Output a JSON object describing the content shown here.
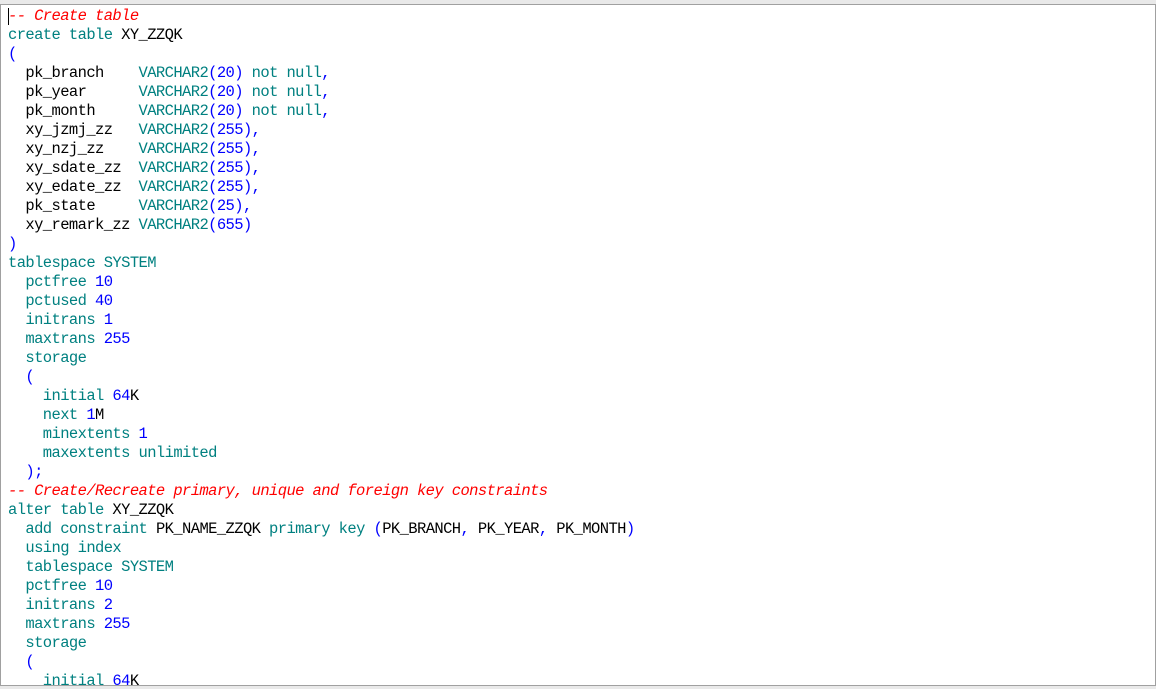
{
  "editor": {
    "lines": [
      [
        {
          "t": "-- Create table",
          "c": "cm"
        }
      ],
      [
        {
          "t": "create table ",
          "c": "kw"
        },
        {
          "t": "XY_ZZQK",
          "c": "id"
        }
      ],
      [
        {
          "t": "(",
          "c": "pun"
        }
      ],
      [
        {
          "t": "  pk_branch    ",
          "c": "id"
        },
        {
          "t": "VARCHAR2",
          "c": "kw"
        },
        {
          "t": "(",
          "c": "pun"
        },
        {
          "t": "20",
          "c": "num"
        },
        {
          "t": ")",
          "c": "pun"
        },
        {
          "t": " not null",
          "c": "kw"
        },
        {
          "t": ",",
          "c": "pun"
        }
      ],
      [
        {
          "t": "  pk_year      ",
          "c": "id"
        },
        {
          "t": "VARCHAR2",
          "c": "kw"
        },
        {
          "t": "(",
          "c": "pun"
        },
        {
          "t": "20",
          "c": "num"
        },
        {
          "t": ")",
          "c": "pun"
        },
        {
          "t": " not null",
          "c": "kw"
        },
        {
          "t": ",",
          "c": "pun"
        }
      ],
      [
        {
          "t": "  pk_month     ",
          "c": "id"
        },
        {
          "t": "VARCHAR2",
          "c": "kw"
        },
        {
          "t": "(",
          "c": "pun"
        },
        {
          "t": "20",
          "c": "num"
        },
        {
          "t": ")",
          "c": "pun"
        },
        {
          "t": " not null",
          "c": "kw"
        },
        {
          "t": ",",
          "c": "pun"
        }
      ],
      [
        {
          "t": "  xy_jzmj_zz   ",
          "c": "id"
        },
        {
          "t": "VARCHAR2",
          "c": "kw"
        },
        {
          "t": "(",
          "c": "pun"
        },
        {
          "t": "255",
          "c": "num"
        },
        {
          "t": ")",
          "c": "pun"
        },
        {
          "t": ",",
          "c": "pun"
        }
      ],
      [
        {
          "t": "  xy_nzj_zz    ",
          "c": "id"
        },
        {
          "t": "VARCHAR2",
          "c": "kw"
        },
        {
          "t": "(",
          "c": "pun"
        },
        {
          "t": "255",
          "c": "num"
        },
        {
          "t": ")",
          "c": "pun"
        },
        {
          "t": ",",
          "c": "pun"
        }
      ],
      [
        {
          "t": "  xy_sdate_zz  ",
          "c": "id"
        },
        {
          "t": "VARCHAR2",
          "c": "kw"
        },
        {
          "t": "(",
          "c": "pun"
        },
        {
          "t": "255",
          "c": "num"
        },
        {
          "t": ")",
          "c": "pun"
        },
        {
          "t": ",",
          "c": "pun"
        }
      ],
      [
        {
          "t": "  xy_edate_zz  ",
          "c": "id"
        },
        {
          "t": "VARCHAR2",
          "c": "kw"
        },
        {
          "t": "(",
          "c": "pun"
        },
        {
          "t": "255",
          "c": "num"
        },
        {
          "t": ")",
          "c": "pun"
        },
        {
          "t": ",",
          "c": "pun"
        }
      ],
      [
        {
          "t": "  pk_state     ",
          "c": "id"
        },
        {
          "t": "VARCHAR2",
          "c": "kw"
        },
        {
          "t": "(",
          "c": "pun"
        },
        {
          "t": "25",
          "c": "num"
        },
        {
          "t": ")",
          "c": "pun"
        },
        {
          "t": ",",
          "c": "pun"
        }
      ],
      [
        {
          "t": "  xy_remark_zz ",
          "c": "id"
        },
        {
          "t": "VARCHAR2",
          "c": "kw"
        },
        {
          "t": "(",
          "c": "pun"
        },
        {
          "t": "655",
          "c": "num"
        },
        {
          "t": ")",
          "c": "pun"
        }
      ],
      [
        {
          "t": ")",
          "c": "pun"
        }
      ],
      [
        {
          "t": "tablespace ",
          "c": "kw"
        },
        {
          "t": "SYSTEM",
          "c": "kw"
        }
      ],
      [
        {
          "t": "  pctfree ",
          "c": "kw"
        },
        {
          "t": "10",
          "c": "num"
        }
      ],
      [
        {
          "t": "  pctused ",
          "c": "kw"
        },
        {
          "t": "40",
          "c": "num"
        }
      ],
      [
        {
          "t": "  initrans ",
          "c": "kw"
        },
        {
          "t": "1",
          "c": "num"
        }
      ],
      [
        {
          "t": "  maxtrans ",
          "c": "kw"
        },
        {
          "t": "255",
          "c": "num"
        }
      ],
      [
        {
          "t": "  storage",
          "c": "kw"
        }
      ],
      [
        {
          "t": "  (",
          "c": "pun"
        }
      ],
      [
        {
          "t": "    initial ",
          "c": "kw"
        },
        {
          "t": "64",
          "c": "num"
        },
        {
          "t": "K",
          "c": "id"
        }
      ],
      [
        {
          "t": "    next ",
          "c": "kw"
        },
        {
          "t": "1",
          "c": "num"
        },
        {
          "t": "M",
          "c": "id"
        }
      ],
      [
        {
          "t": "    minextents ",
          "c": "kw"
        },
        {
          "t": "1",
          "c": "num"
        }
      ],
      [
        {
          "t": "    maxextents unlimited",
          "c": "kw"
        }
      ],
      [
        {
          "t": "  );",
          "c": "pun"
        }
      ],
      [
        {
          "t": "-- Create/Recreate primary, unique and foreign key constraints",
          "c": "cm"
        }
      ],
      [
        {
          "t": "alter table ",
          "c": "kw"
        },
        {
          "t": "XY_ZZQK",
          "c": "id"
        }
      ],
      [
        {
          "t": "  add constraint ",
          "c": "kw"
        },
        {
          "t": "PK_NAME_ZZQK",
          "c": "id"
        },
        {
          "t": " primary key ",
          "c": "kw"
        },
        {
          "t": "(",
          "c": "pun"
        },
        {
          "t": "PK_BRANCH",
          "c": "id"
        },
        {
          "t": ", ",
          "c": "pun"
        },
        {
          "t": "PK_YEAR",
          "c": "id"
        },
        {
          "t": ", ",
          "c": "pun"
        },
        {
          "t": "PK_MONTH",
          "c": "id"
        },
        {
          "t": ")",
          "c": "pun"
        }
      ],
      [
        {
          "t": "  using index",
          "c": "kw"
        }
      ],
      [
        {
          "t": "  tablespace ",
          "c": "kw"
        },
        {
          "t": "SYSTEM",
          "c": "kw"
        }
      ],
      [
        {
          "t": "  pctfree ",
          "c": "kw"
        },
        {
          "t": "10",
          "c": "num"
        }
      ],
      [
        {
          "t": "  initrans ",
          "c": "kw"
        },
        {
          "t": "2",
          "c": "num"
        }
      ],
      [
        {
          "t": "  maxtrans ",
          "c": "kw"
        },
        {
          "t": "255",
          "c": "num"
        }
      ],
      [
        {
          "t": "  storage",
          "c": "kw"
        }
      ],
      [
        {
          "t": "  (",
          "c": "pun"
        }
      ],
      [
        {
          "t": "    initial ",
          "c": "kw"
        },
        {
          "t": "64",
          "c": "num"
        },
        {
          "t": "K",
          "c": "id"
        }
      ]
    ]
  }
}
